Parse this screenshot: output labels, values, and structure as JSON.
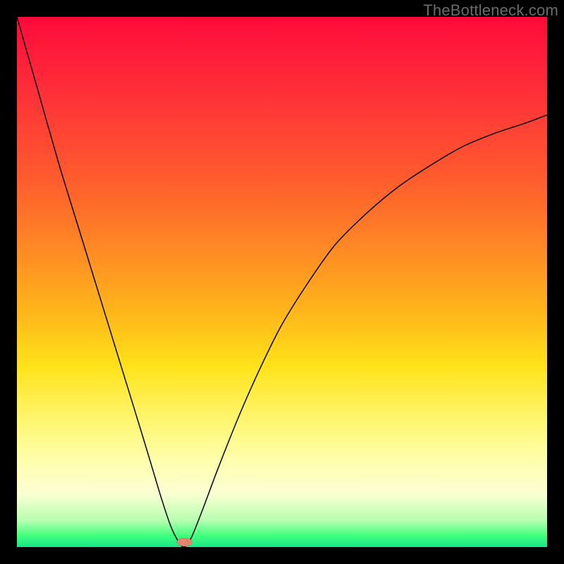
{
  "watermark": "TheBottleneck.com",
  "chart_data": {
    "type": "line",
    "title": "",
    "xlabel": "",
    "ylabel": "",
    "xlim": [
      0,
      100
    ],
    "ylim": [
      0,
      100
    ],
    "grid": false,
    "gradient": {
      "top": "#ff0a3a",
      "mid_upper": "#ff8a24",
      "mid": "#ffe31a",
      "mid_lower": "#fbffd2",
      "bottom": "#18e58a"
    },
    "series": [
      {
        "name": "bottleneck-curve",
        "x": [
          0,
          4,
          8,
          12,
          16,
          20,
          24,
          27,
          29,
          30.5,
          31.6,
          33,
          35,
          38,
          42,
          46,
          50,
          55,
          60,
          66,
          72,
          78,
          84,
          90,
          96,
          100
        ],
        "y": [
          100,
          86,
          72,
          59,
          46,
          33,
          20,
          10,
          4,
          1,
          0,
          2,
          7,
          15,
          25,
          34,
          42,
          50,
          57,
          63,
          68,
          72,
          75.5,
          78,
          80,
          81.5
        ]
      }
    ],
    "marker": {
      "x": 31.6,
      "y": 0,
      "color": "#e58570",
      "shape": "pill"
    }
  }
}
